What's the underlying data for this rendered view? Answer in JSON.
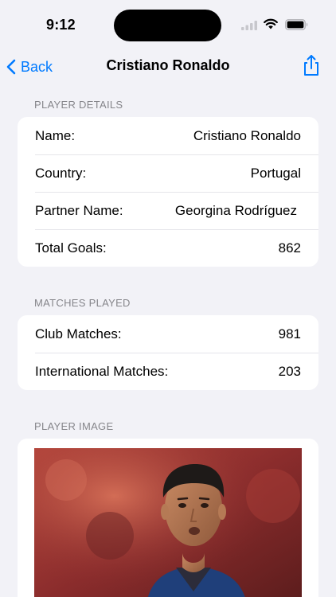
{
  "status": {
    "time": "9:12"
  },
  "nav": {
    "back_label": "Back",
    "title": "Cristiano Ronaldo"
  },
  "player_details": {
    "header": "PLAYER DETAILS",
    "rows": [
      {
        "label": "Name:",
        "value": "Cristiano Ronaldo"
      },
      {
        "label": "Country:",
        "value": "Portugal"
      },
      {
        "label": "Partner Name:",
        "value": "Georgina Rodríguez"
      },
      {
        "label": "Total Goals:",
        "value": "862"
      }
    ]
  },
  "matches_played": {
    "header": "MATCHES PLAYED",
    "rows": [
      {
        "label": "Club Matches:",
        "value": "981"
      },
      {
        "label": "International Matches:",
        "value": "203"
      }
    ]
  },
  "player_image": {
    "header": "PLAYER IMAGE"
  },
  "colors": {
    "accent": "#007aff",
    "background": "#f2f2f7",
    "card": "#ffffff",
    "header_text": "#86868b"
  },
  "icons": {
    "back": "chevron-left-icon",
    "share": "share-icon",
    "signal": "cellular-signal-icon",
    "wifi": "wifi-icon",
    "battery": "battery-icon"
  }
}
